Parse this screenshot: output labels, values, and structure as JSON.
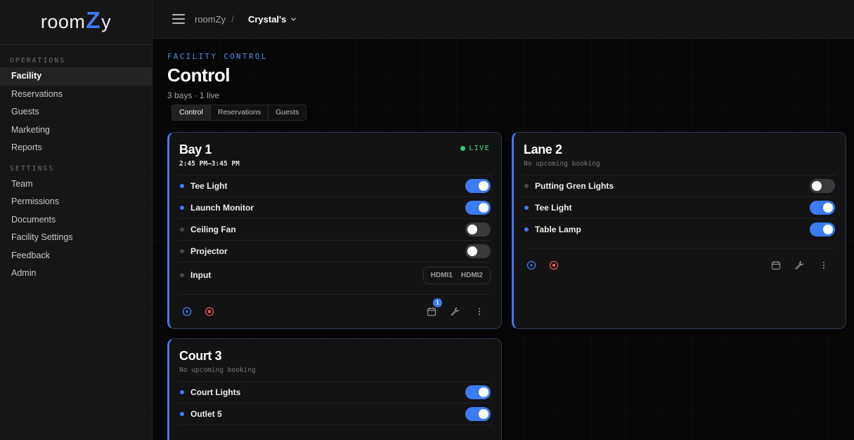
{
  "brand": {
    "pre": "room",
    "z": "Z",
    "post": "y"
  },
  "sidebar": {
    "sections": [
      {
        "title": "OPERATIONS",
        "items": [
          "Facility",
          "Reservations",
          "Guests",
          "Marketing",
          "Reports"
        ]
      },
      {
        "title": "SETTINGS",
        "items": [
          "Team",
          "Permissions",
          "Documents",
          "Facility Settings",
          "Feedback",
          "Admin"
        ]
      }
    ],
    "active": "Facility"
  },
  "topbar": {
    "root": "roomZy",
    "sep": "/",
    "current": "Crystal's"
  },
  "header": {
    "kicker": "FACILITY CONTROL",
    "title": "Control",
    "subtitle": "3 bays · 1 live"
  },
  "tabs": [
    "Control",
    "Reservations",
    "Guests"
  ],
  "cards": [
    {
      "title": "Bay 1",
      "time": "2:45 PM–3:45 PM",
      "live": "LIVE",
      "devices": [
        {
          "label": "Tee Light",
          "on": true
        },
        {
          "label": "Launch Monitor",
          "on": true
        },
        {
          "label": "Ceiling Fan",
          "on": false
        },
        {
          "label": "Projector",
          "on": false
        }
      ],
      "input": {
        "label": "Input",
        "options": [
          "HDMI1",
          "HDMI2"
        ]
      },
      "calendar_badge": "1"
    },
    {
      "title": "Lane 2",
      "no_booking": "No upcoming booking",
      "devices": [
        {
          "label": "Putting Gren Lights",
          "on": false
        },
        {
          "label": "Tee Light",
          "on": true
        },
        {
          "label": "Table Lamp",
          "on": true
        }
      ]
    },
    {
      "title": "Court 3",
      "no_booking": "No upcoming booking",
      "devices": [
        {
          "label": "Court Lights",
          "on": true
        },
        {
          "label": "Outlet 5",
          "on": true
        }
      ]
    }
  ],
  "colors": {
    "accent": "#3b7cf4",
    "live": "#3ddc84",
    "stop": "#e5534b"
  }
}
